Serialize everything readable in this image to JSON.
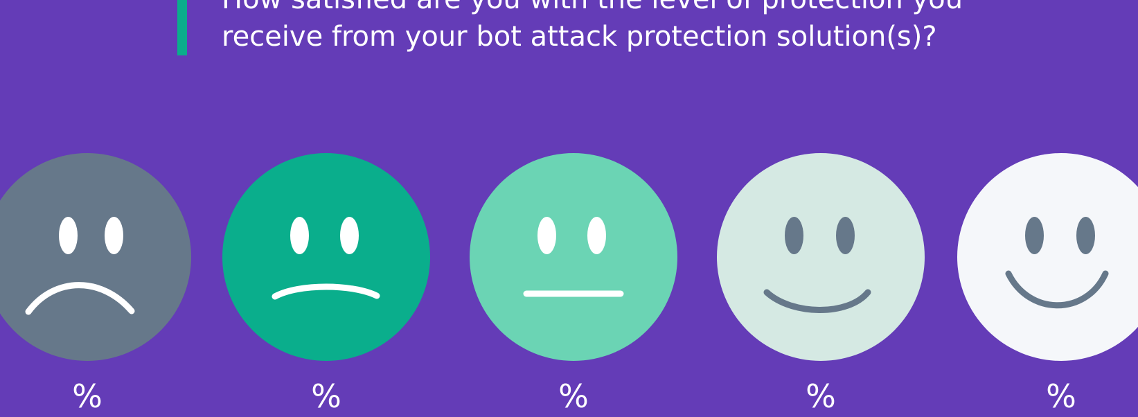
{
  "question": {
    "text": "How satisfied are you with the level of protection you\nreceive from your bot attack protection solution(s)?"
  },
  "colors": {
    "background": "#643cb7",
    "accent_bar": "#0aae8c"
  },
  "faces": [
    {
      "name": "very-dissatisfied",
      "icon": "very-sad-face-icon",
      "face_color": "#66788a",
      "feature_color": "#ffffff",
      "percent": "%"
    },
    {
      "name": "dissatisfied",
      "icon": "sad-face-icon",
      "face_color": "#0aae8c",
      "feature_color": "#ffffff",
      "percent": "%"
    },
    {
      "name": "neutral",
      "icon": "neutral-face-icon",
      "face_color": "#6bd4b4",
      "feature_color": "#ffffff",
      "percent": "%"
    },
    {
      "name": "satisfied",
      "icon": "smile-face-icon",
      "face_color": "#d5e9e3",
      "feature_color": "#66788a",
      "percent": "%"
    },
    {
      "name": "very-satisfied",
      "icon": "big-smile-face-icon",
      "face_color": "#f5f7fa",
      "feature_color": "#66788a",
      "percent": "%"
    }
  ]
}
